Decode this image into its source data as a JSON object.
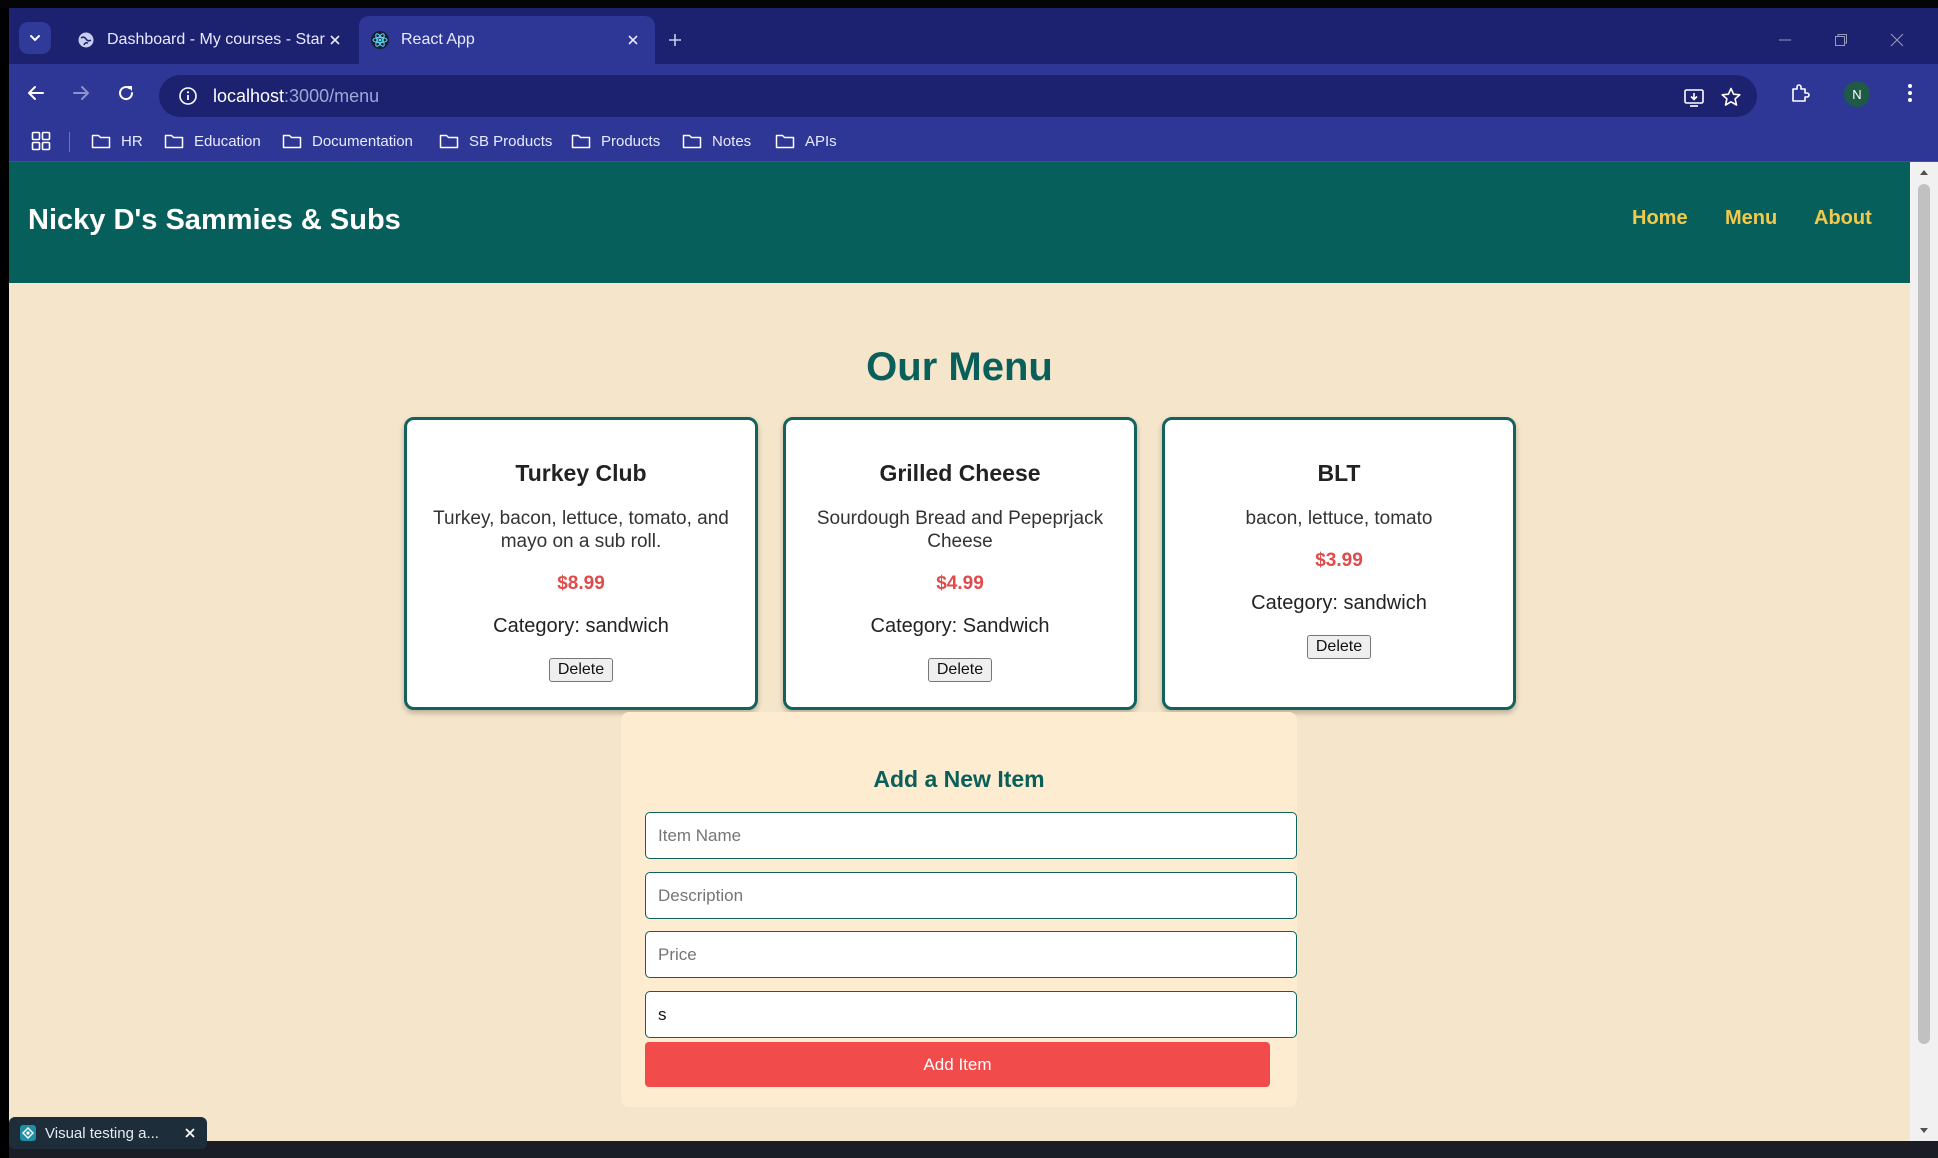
{
  "browser": {
    "tabs": [
      {
        "title": "Dashboard - My courses - Start",
        "active": false
      },
      {
        "title": "React App",
        "active": true
      }
    ],
    "url_host": "localhost",
    "url_path": ":3000/menu",
    "profile_initial": "N",
    "bookmarks": [
      "HR",
      "Education",
      "Documentation",
      "SB Products",
      "Products",
      "Notes",
      "APIs"
    ]
  },
  "site": {
    "brand": "Nicky D's Sammies & Subs",
    "nav": [
      "Home",
      "Menu",
      "About"
    ]
  },
  "menu": {
    "title": "Our Menu",
    "items": [
      {
        "name": "Turkey Club",
        "description": "Turkey, bacon, lettuce, tomato, and mayo on a sub roll.",
        "price": "$8.99",
        "category": "Category: sandwich",
        "delete_label": "Delete"
      },
      {
        "name": "Grilled Cheese",
        "description": "Sourdough Bread and Pepeprjack Cheese",
        "price": "$4.99",
        "category": "Category: Sandwich",
        "delete_label": "Delete"
      },
      {
        "name": "BLT",
        "description": "bacon, lettuce, tomato",
        "price": "$3.99",
        "category": "Category: sandwich",
        "delete_label": "Delete"
      }
    ]
  },
  "form": {
    "title": "Add a New Item",
    "item_name_placeholder": "Item Name",
    "description_placeholder": "Description",
    "price_placeholder": "Price",
    "category_value": "s",
    "submit_label": "Add Item"
  },
  "toast": {
    "label": "Visual testing a..."
  },
  "colors": {
    "header_bg": "#075f5c",
    "nav_link": "#f3c94b",
    "page_bg": "#f5e6cb",
    "price": "#e24a4a",
    "button": "#f24b4b"
  }
}
